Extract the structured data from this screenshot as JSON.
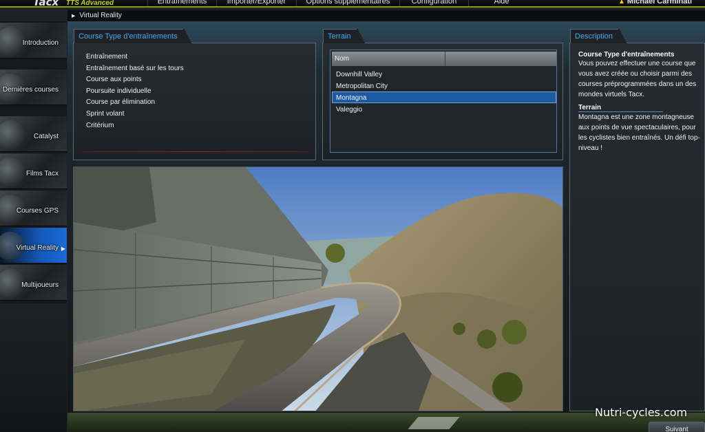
{
  "app": {
    "logo": "Tacx",
    "product": "TTS Advanced"
  },
  "menu": [
    {
      "label": "Entraînements"
    },
    {
      "label": "Importer/Exporter"
    },
    {
      "label": "Options supplémentaires"
    },
    {
      "label": "Configuration"
    },
    {
      "label": "Aide"
    }
  ],
  "user": {
    "name": "Michael Carminati",
    "icon": "warning-icon"
  },
  "breadcrumb": {
    "label": "Virtual Reality"
  },
  "sidebar": {
    "items": [
      {
        "label": "Introduction"
      },
      {
        "label": "Dernières courses"
      },
      {
        "label": "Catalyst"
      },
      {
        "label": "Films Tacx"
      },
      {
        "label": "Courses GPS"
      },
      {
        "label": "Virtual Reality",
        "active": true
      },
      {
        "label": "Multijoueurs"
      }
    ]
  },
  "types_panel": {
    "tab": "Course Type d'entraînements",
    "items": [
      "Entraînement",
      "Entraînement basé sur les tours",
      "Course aux points",
      "Poursuite individuelle",
      "Course par élimination",
      "Sprint volant",
      "Critérium"
    ]
  },
  "terrain_panel": {
    "tab": "Terrain",
    "column": "Nom",
    "rows": [
      {
        "name": "Downhill Valley"
      },
      {
        "name": "Metropolitan City"
      },
      {
        "name": "Montagna",
        "selected": true
      },
      {
        "name": "Valeggio"
      }
    ]
  },
  "description_panel": {
    "tab": "Description",
    "heading1": "Course Type d'entraînements",
    "text1": "Vous pouvez effectuer une course que vous avez créée ou choisir parmi des courses préprogrammées dans un des mondes virtuels Tacx.",
    "heading2": "Terrain",
    "text2": "Montagna est une zone montagneuse aux points de vue spectaculaires, pour les cyclistes bien entraînés. Un défi top-niveau !"
  },
  "footer": {
    "next_label": "Suivant",
    "watermark": "Nutri-cycles.com"
  },
  "colors": {
    "accent_green": "#8ea000",
    "tab_text": "#4aa8e8",
    "selection": "#1f5aa0"
  }
}
